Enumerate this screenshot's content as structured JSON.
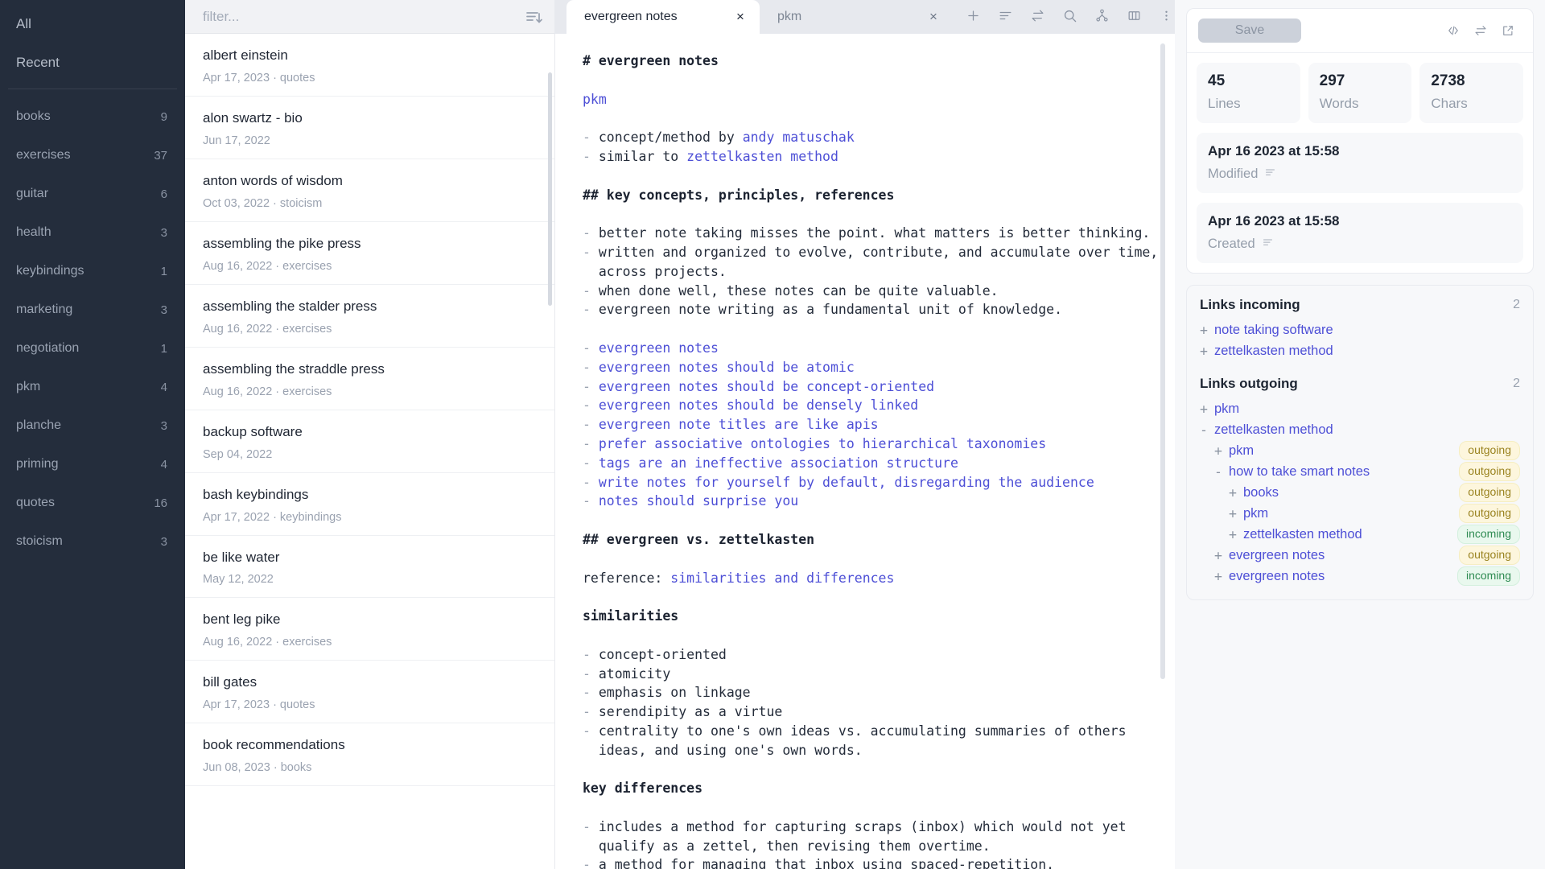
{
  "sidebar": {
    "top_items": [
      {
        "label": "All"
      },
      {
        "label": "Recent"
      }
    ],
    "tags": [
      {
        "label": "books",
        "count": "9"
      },
      {
        "label": "exercises",
        "count": "37"
      },
      {
        "label": "guitar",
        "count": "6"
      },
      {
        "label": "health",
        "count": "3"
      },
      {
        "label": "keybindings",
        "count": "1"
      },
      {
        "label": "marketing",
        "count": "3"
      },
      {
        "label": "negotiation",
        "count": "1"
      },
      {
        "label": "pkm",
        "count": "4"
      },
      {
        "label": "planche",
        "count": "3"
      },
      {
        "label": "priming",
        "count": "4"
      },
      {
        "label": "quotes",
        "count": "16"
      },
      {
        "label": "stoicism",
        "count": "3"
      }
    ]
  },
  "notelist": {
    "filter_placeholder": "filter...",
    "filter_value": "",
    "sort_icon": "sort-descending-icon",
    "notes": [
      {
        "title": "albert einstein",
        "meta": "Apr 17, 2023 · quotes"
      },
      {
        "title": "alon swartz - bio",
        "meta": "Jun 17, 2022"
      },
      {
        "title": "anton words of wisdom",
        "meta": "Oct 03, 2022 · stoicism"
      },
      {
        "title": "assembling the pike press",
        "meta": "Aug 16, 2022 · exercises"
      },
      {
        "title": "assembling the stalder press",
        "meta": "Aug 16, 2022 · exercises"
      },
      {
        "title": "assembling the straddle press",
        "meta": "Aug 16, 2022 · exercises"
      },
      {
        "title": "backup software",
        "meta": "Sep 04, 2022"
      },
      {
        "title": "bash keybindings",
        "meta": "Apr 17, 2022 · keybindings"
      },
      {
        "title": "be like water",
        "meta": "May 12, 2022"
      },
      {
        "title": "bent leg pike",
        "meta": "Aug 16, 2022 · exercises"
      },
      {
        "title": "bill gates",
        "meta": "Apr 17, 2023 · quotes"
      },
      {
        "title": "book recommendations",
        "meta": "Jun 08, 2023 · books"
      }
    ]
  },
  "tabs": [
    {
      "label": "evergreen notes",
      "close": "×",
      "active": true
    },
    {
      "label": "pkm",
      "close": "×",
      "active": false
    }
  ],
  "toolbar_icons": [
    {
      "name": "plus-icon"
    },
    {
      "name": "lines-icon"
    },
    {
      "name": "swap-icon"
    },
    {
      "name": "search-icon"
    },
    {
      "name": "graph-icon"
    },
    {
      "name": "columns-icon"
    },
    {
      "name": "more-vertical-icon"
    }
  ],
  "editor": {
    "lines": [
      {
        "text": "# evergreen notes",
        "kind": "head"
      },
      {
        "text": "",
        "kind": "blank"
      },
      {
        "text": "pkm",
        "kind": "link"
      },
      {
        "text": "",
        "kind": "blank"
      },
      {
        "text": "- concept/method by andy matuschak",
        "kind": "bullet-link",
        "plain": "concept/method by ",
        "link": "andy matuschak"
      },
      {
        "text": "- similar to zettelkasten method",
        "kind": "bullet-link",
        "plain": "similar to ",
        "link": "zettelkasten method"
      },
      {
        "text": "",
        "kind": "blank"
      },
      {
        "text": "## key concepts, principles, references",
        "kind": "head"
      },
      {
        "text": "",
        "kind": "blank"
      },
      {
        "text": "- better note taking misses the point. what matters is better thinking.",
        "kind": "bullet"
      },
      {
        "text": "- written and organized to evolve, contribute, and accumulate over time,",
        "kind": "bullet"
      },
      {
        "text": "  across projects.",
        "kind": "plain"
      },
      {
        "text": "- when done well, these notes can be quite valuable.",
        "kind": "bullet"
      },
      {
        "text": "- evergreen note writing as a fundamental unit of knowledge.",
        "kind": "bullet"
      },
      {
        "text": "",
        "kind": "blank"
      },
      {
        "text": "- evergreen notes",
        "kind": "bullet-all-link",
        "link": "evergreen notes"
      },
      {
        "text": "- evergreen notes should be atomic",
        "kind": "bullet-all-link",
        "link": "evergreen notes should be atomic"
      },
      {
        "text": "- evergreen notes should be concept-oriented",
        "kind": "bullet-all-link",
        "link": "evergreen notes should be concept-oriented"
      },
      {
        "text": "- evergreen notes should be densely linked",
        "kind": "bullet-all-link",
        "link": "evergreen notes should be densely linked"
      },
      {
        "text": "- evergreen note titles are like apis",
        "kind": "bullet-all-link",
        "link": "evergreen note titles are like apis"
      },
      {
        "text": "- prefer associative ontologies to hierarchical taxonomies",
        "kind": "bullet-all-link",
        "link": "prefer associative ontologies to hierarchical taxonomies"
      },
      {
        "text": "- tags are an ineffective association structure",
        "kind": "bullet-all-link",
        "link": "tags are an ineffective association structure"
      },
      {
        "text": "- write notes for yourself by default, disregarding the audience",
        "kind": "bullet-all-link",
        "link": "write notes for yourself by default, disregarding the audience"
      },
      {
        "text": "- notes should surprise you",
        "kind": "bullet-all-link",
        "link": "notes should surprise you"
      },
      {
        "text": "",
        "kind": "blank"
      },
      {
        "text": "## evergreen vs. zettelkasten",
        "kind": "head"
      },
      {
        "text": "",
        "kind": "blank"
      },
      {
        "text": "reference: similarities and differences",
        "kind": "plain-link",
        "plain": "reference: ",
        "link": "similarities and differences"
      },
      {
        "text": "",
        "kind": "blank"
      },
      {
        "text": "similarities",
        "kind": "head"
      },
      {
        "text": "",
        "kind": "blank"
      },
      {
        "text": "- concept-oriented",
        "kind": "bullet"
      },
      {
        "text": "- atomicity",
        "kind": "bullet"
      },
      {
        "text": "- emphasis on linkage",
        "kind": "bullet"
      },
      {
        "text": "- serendipity as a virtue",
        "kind": "bullet"
      },
      {
        "text": "- centrality to one's own ideas vs. accumulating summaries of others",
        "kind": "bullet"
      },
      {
        "text": "  ideas, and using one's own words.",
        "kind": "plain"
      },
      {
        "text": "",
        "kind": "blank"
      },
      {
        "text": "key differences",
        "kind": "head"
      },
      {
        "text": "",
        "kind": "blank"
      },
      {
        "text": "- includes a method for capturing scraps (inbox) which would not yet",
        "kind": "bullet"
      },
      {
        "text": "  qualify as a zettel, then revising them overtime.",
        "kind": "plain"
      },
      {
        "text": "- a method for managing that inbox using spaced-repetition.",
        "kind": "bullet"
      }
    ]
  },
  "rightpanel": {
    "save_label": "Save",
    "tool_icons": [
      {
        "name": "code-icon"
      },
      {
        "name": "swap-icon"
      },
      {
        "name": "external-link-icon"
      }
    ],
    "stats": [
      {
        "value": "45",
        "label": "Lines"
      },
      {
        "value": "297",
        "label": "Words"
      },
      {
        "value": "2738",
        "label": "Chars"
      }
    ],
    "dates": [
      {
        "value": "Apr 16 2023 at 15:58",
        "label": "Modified"
      },
      {
        "value": "Apr 16 2023 at 15:58",
        "label": "Created"
      }
    ],
    "links_incoming": {
      "title": "Links incoming",
      "count": "2",
      "items": [
        {
          "twisty": "+",
          "name": "note taking software",
          "indent": 0,
          "badge": ""
        },
        {
          "twisty": "+",
          "name": "zettelkasten method",
          "indent": 0,
          "badge": ""
        }
      ]
    },
    "links_outgoing": {
      "title": "Links outgoing",
      "count": "2",
      "items": [
        {
          "twisty": "+",
          "name": "pkm",
          "indent": 0,
          "badge": ""
        },
        {
          "twisty": "-",
          "name": "zettelkasten method",
          "indent": 0,
          "badge": ""
        },
        {
          "twisty": "+",
          "name": "pkm",
          "indent": 1,
          "badge": "outgoing"
        },
        {
          "twisty": "-",
          "name": "how to take smart notes",
          "indent": 1,
          "badge": "outgoing"
        },
        {
          "twisty": "+",
          "name": "books",
          "indent": 2,
          "badge": "outgoing"
        },
        {
          "twisty": "+",
          "name": "pkm",
          "indent": 2,
          "badge": "outgoing"
        },
        {
          "twisty": "+",
          "name": "zettelkasten method",
          "indent": 2,
          "badge": "incoming"
        },
        {
          "twisty": "+",
          "name": "evergreen notes",
          "indent": 1,
          "badge": "outgoing"
        },
        {
          "twisty": "+",
          "name": "evergreen notes",
          "indent": 1,
          "badge": "incoming"
        }
      ]
    }
  },
  "colors": {
    "sidebar_bg": "#242d3c",
    "link": "#4d4fd6",
    "badge_outgoing": "#9a8320",
    "badge_incoming": "#2f8b52"
  }
}
